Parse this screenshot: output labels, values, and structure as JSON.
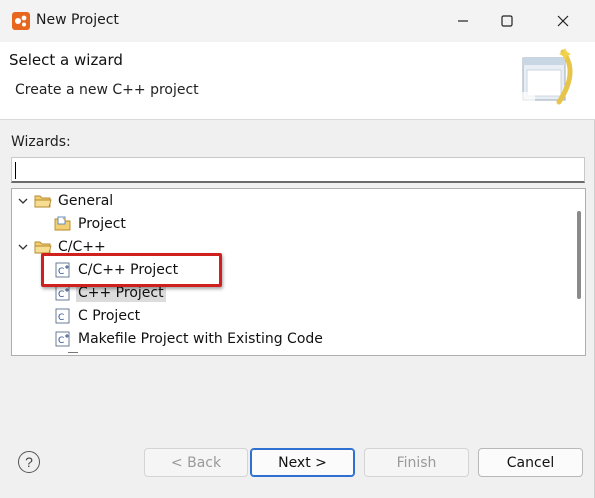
{
  "window": {
    "title": "New Project",
    "icon": "eclipse-app-icon"
  },
  "banner": {
    "title": "Select a wizard",
    "subtitle": "Create a new C++ project"
  },
  "wizards": {
    "label": "Wizards:",
    "filter_value": "",
    "tree": [
      {
        "label": "General",
        "expanded": true,
        "icon": "folder-icon",
        "level": 0
      },
      {
        "label": "Project",
        "icon": "project-icon",
        "level": 1
      },
      {
        "label": "C/C++",
        "expanded": true,
        "icon": "folder-icon",
        "level": 0
      },
      {
        "label": "C/C++ Project",
        "icon": "cpp-file-icon",
        "level": 1,
        "highlighted": true
      },
      {
        "label": "C++ Project",
        "icon": "cpp-file-icon",
        "level": 1,
        "selected": true
      },
      {
        "label": "C Project",
        "icon": "c-file-icon",
        "level": 1
      },
      {
        "label": "Makefile Project with Existing Code",
        "icon": "makefile-icon",
        "level": 1
      }
    ]
  },
  "footer": {
    "help_label": "?",
    "back_label": "< Back",
    "next_label": "Next >",
    "finish_label": "Finish",
    "cancel_label": "Cancel"
  },
  "colors": {
    "highlight_border": "#d0201e",
    "primary_button_border": "#2f6fd0",
    "app_icon": "#e8671f"
  }
}
